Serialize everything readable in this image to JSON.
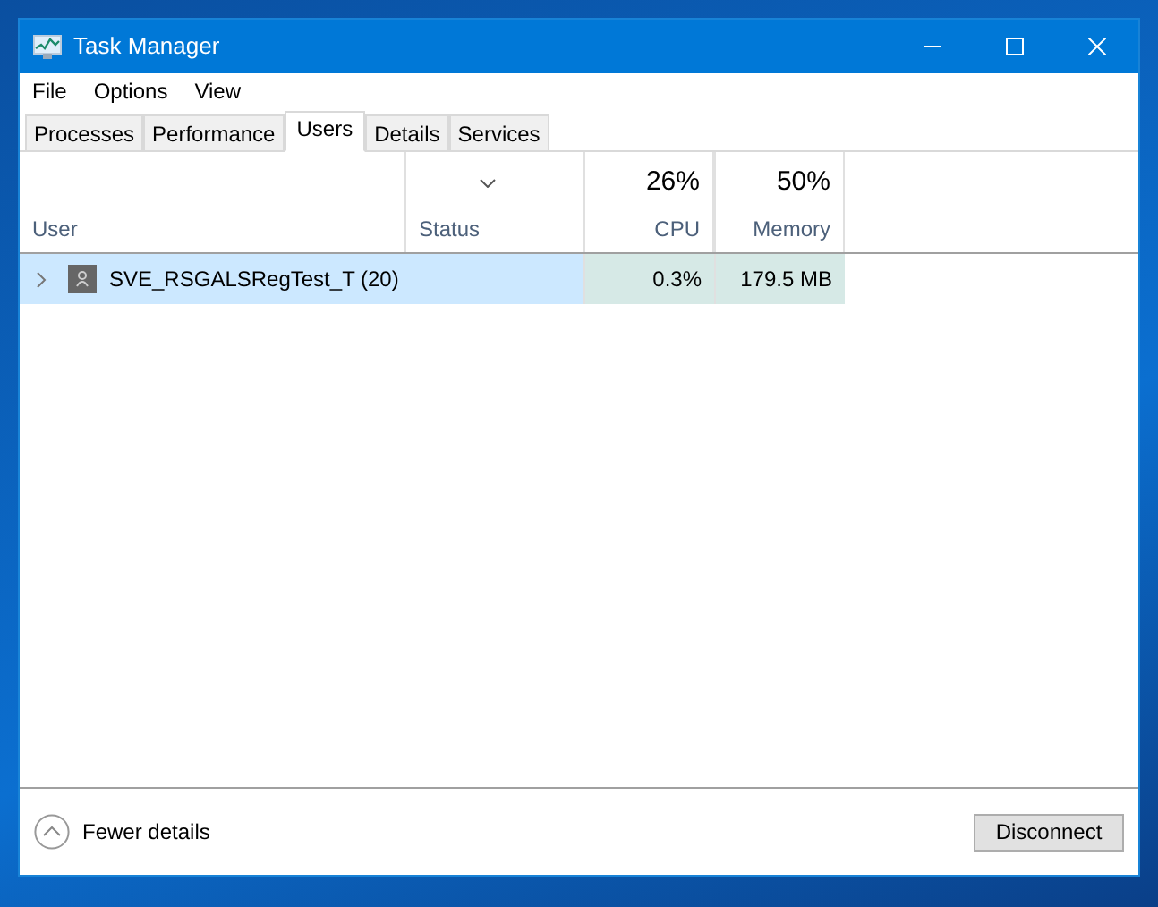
{
  "window": {
    "title": "Task Manager"
  },
  "menu": [
    "File",
    "Options",
    "View"
  ],
  "tabs": [
    {
      "label": "Processes",
      "selected": false
    },
    {
      "label": "Performance",
      "selected": false
    },
    {
      "label": "Users",
      "selected": true
    },
    {
      "label": "Details",
      "selected": false
    },
    {
      "label": "Services",
      "selected": false
    }
  ],
  "table": {
    "columns": [
      {
        "label": "User",
        "kind": "text",
        "sorted": false
      },
      {
        "label": "Status",
        "kind": "text",
        "sorted": true
      },
      {
        "label": "CPU",
        "kind": "usage",
        "total": "26%",
        "sorted": false
      },
      {
        "label": "Memory",
        "kind": "usage",
        "total": "50%",
        "sorted": false
      }
    ],
    "rows": [
      {
        "user": "SVE_RSGALSRegTest_T (20)",
        "status": "",
        "cpu": "0.3%",
        "memory": "179.5 MB",
        "selected": true,
        "expanded": false
      }
    ]
  },
  "footer": {
    "toggle": "Fewer details",
    "button": "Disconnect"
  }
}
